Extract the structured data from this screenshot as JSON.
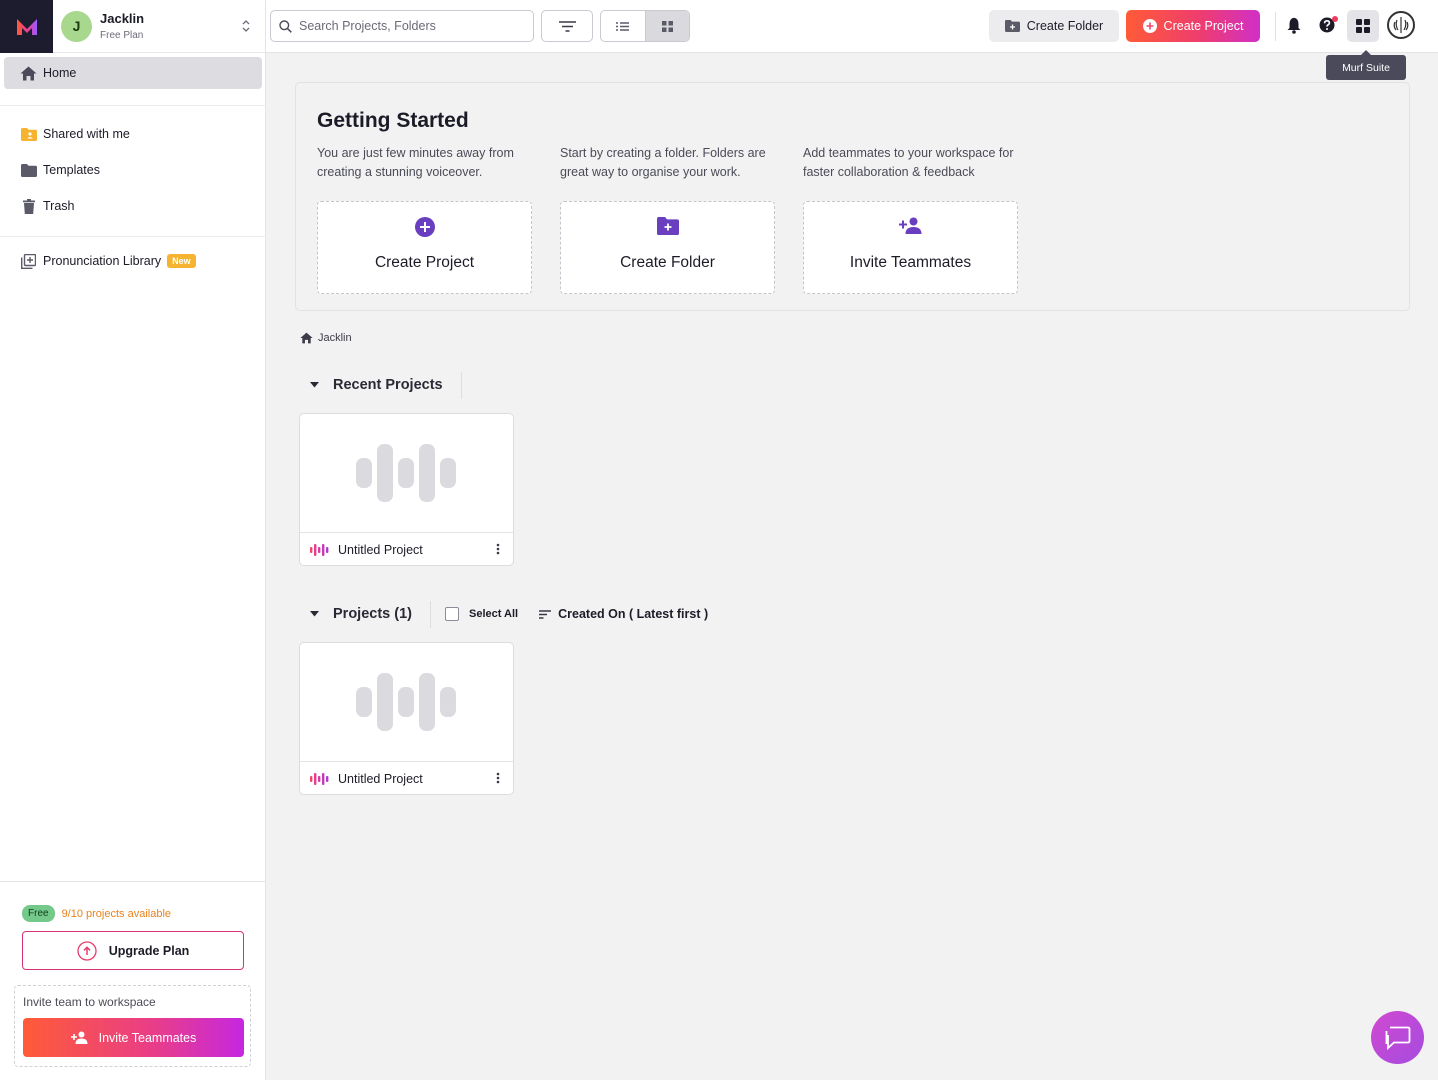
{
  "account": {
    "initial": "J",
    "name": "Jacklin",
    "plan": "Free Plan"
  },
  "nav": {
    "home": "Home",
    "shared": "Shared with me",
    "templates": "Templates",
    "trash": "Trash",
    "pronunciation": "Pronunciation Library",
    "new_badge": "New"
  },
  "usage": {
    "badge": "Free",
    "available": "9/10 projects available",
    "upgrade": "Upgrade Plan"
  },
  "invite": {
    "label": "Invite team to workspace",
    "button": "Invite Teammates"
  },
  "topbar": {
    "search_placeholder": "Search Projects, Folders",
    "create_folder": "Create Folder",
    "create_project": "Create Project",
    "tooltip": "Murf Suite"
  },
  "getting_started": {
    "title": "Getting Started",
    "cards": [
      {
        "desc": "You are just few minutes away from creating a stunning voiceover.",
        "label": "Create Project"
      },
      {
        "desc": "Start by creating a folder. Folders are great way to organise your work.",
        "label": "Create Folder"
      },
      {
        "desc": "Add teammates to your workspace for faster collaboration & feedback",
        "label": "Invite Teammates"
      }
    ]
  },
  "breadcrumb": "Jacklin",
  "recent": {
    "title": "Recent Projects",
    "items": [
      {
        "name": "Untitled Project"
      }
    ]
  },
  "projects": {
    "title": "Projects (1)",
    "select_all": "Select All",
    "sort": "Created On ( Latest first )",
    "items": [
      {
        "name": "Untitled Project"
      }
    ]
  },
  "colors": {
    "accent": "#6a3fbf",
    "brand_gradient_start": "#ff5b37",
    "brand_gradient_end": "#c627e0",
    "warning": "#e8821e"
  }
}
